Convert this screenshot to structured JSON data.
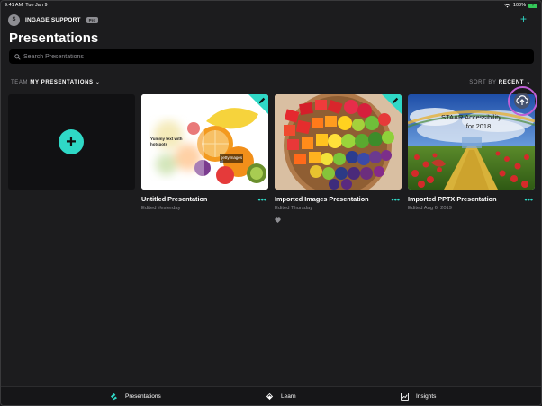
{
  "status": {
    "time": "9:41 AM",
    "date": "Tue Jan 9",
    "battery": "100%"
  },
  "org": {
    "avatar_letter": "S",
    "name": "INGAGE SUPPORT",
    "badge": "Pro"
  },
  "header": {
    "title": "Presentations",
    "add_icon": "plus-icon"
  },
  "search": {
    "placeholder": "Search Presentations",
    "value": ""
  },
  "filters": {
    "team_label": "TEAM",
    "team_value": "MY PRESENTATIONS",
    "sort_label": "SORT BY",
    "sort_value": "RECENT"
  },
  "new_card": {
    "icon": "plus-icon"
  },
  "presentations": [
    {
      "title": "Untitled Presentation",
      "subtitle": "Edited Yesterday",
      "thumb_text": "Yummy text with hotspots",
      "thumb_watermark": "gettyimages",
      "more": "•••",
      "edit_icon": "pencil-icon"
    },
    {
      "title": "Imported Images Presentation",
      "subtitle": "Edited Thursday",
      "more": "•••",
      "edit_icon": "pencil-icon",
      "favorite": true
    },
    {
      "title": "Imported PPTX Presentation",
      "subtitle": "Edited Aug 6, 2019",
      "thumb_text_line1": "STAAR Accessibility",
      "thumb_text_line2": "for 2018",
      "more": "•••",
      "status_icon": "cloud-upload-icon"
    }
  ],
  "tabs": [
    {
      "label": "Presentations",
      "icon": "presentations-icon",
      "active": true
    },
    {
      "label": "Learn",
      "icon": "learn-icon",
      "active": false
    },
    {
      "label": "Insights",
      "icon": "insights-icon",
      "active": false
    }
  ],
  "colors": {
    "accent": "#2fd8c6",
    "highlight": "#c05fd6",
    "background": "#1c1c1e"
  }
}
